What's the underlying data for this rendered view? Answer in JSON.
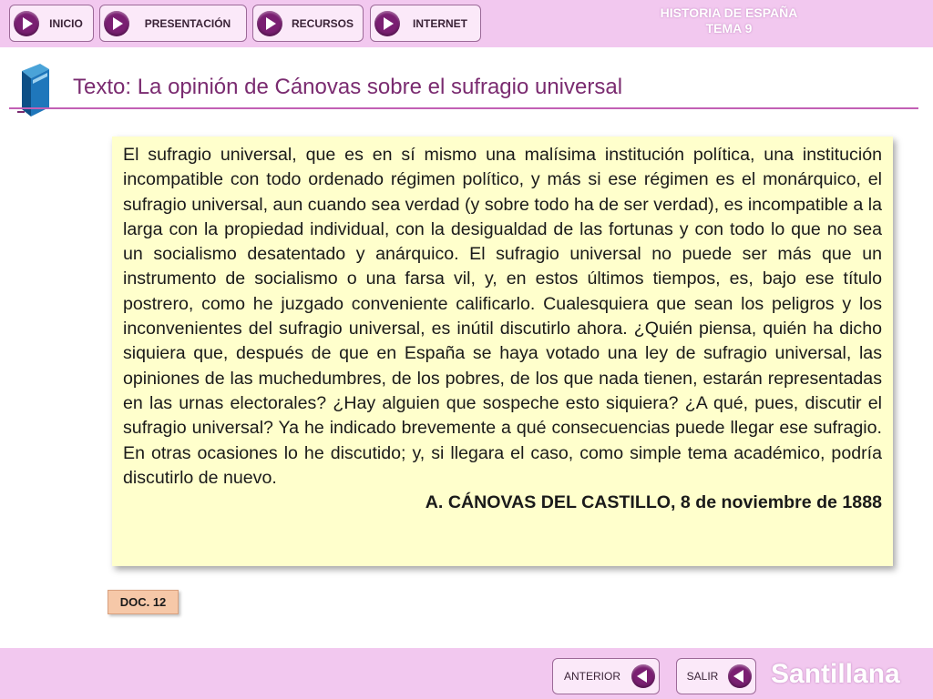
{
  "nav": {
    "inicio": "INICIO",
    "presentacion": "PRESENTACIÓN",
    "recursos": "RECURSOS",
    "internet": "INTERNET"
  },
  "brand": {
    "line1": "HISTORIA DE ESPAÑA",
    "line2": "TEMA 9"
  },
  "title": "Texto: La opinión de Cánovas sobre el sufragio universal",
  "text": {
    "body": "El sufragio universal, que es en sí mismo una malísima institución política, una institución incompatible con todo ordenado régimen político, y más si ese régimen es el monárquico, el sufragio universal, aun cuando sea verdad (y sobre todo ha de ser verdad), es incompatible a la larga con la propiedad individual, con la desigualdad de las fortunas y con todo lo que no sea un socialismo desatentado y anárquico. El sufragio universal no puede ser más que un instrumento de socialismo o una farsa vil, y, en estos últimos tiempos, es, bajo ese título postrero, como he juzgado conveniente calificarlo. Cualesquiera que sean los peligros y los inconvenientes del sufragio universal, es inútil discutirlo ahora. ¿Quién piensa, quién ha dicho siquiera que, después de que en España se haya votado una ley de sufragio universal, las opiniones de las muchedumbres, de los pobres, de los que nada tienen, estarán representadas en las urnas electorales? ¿Hay alguien que sospeche esto siquiera? ¿A qué, pues, discutir el sufragio universal? Ya he indicado brevemente a qué consecuencias puede llegar ese sufragio. En otras ocasiones lo he discutido; y, si llegara el caso, como simple tema académico, podría discutirlo de nuevo.",
    "author": "A. CÁNOVAS DEL CASTILLO, 8 de noviembre de 1888"
  },
  "doc_label": "DOC. 12",
  "bottom": {
    "anterior": "ANTERIOR",
    "salir": "SALIR"
  },
  "logo": "Santillana",
  "icons": {
    "nav": "play-icon",
    "back": "back-arrow-icon",
    "book": "book-icon"
  },
  "colors": {
    "bar": "#f2c8ef",
    "accent": "#7a1f72",
    "title": "#7a2b70",
    "card": "#ffffcc"
  }
}
